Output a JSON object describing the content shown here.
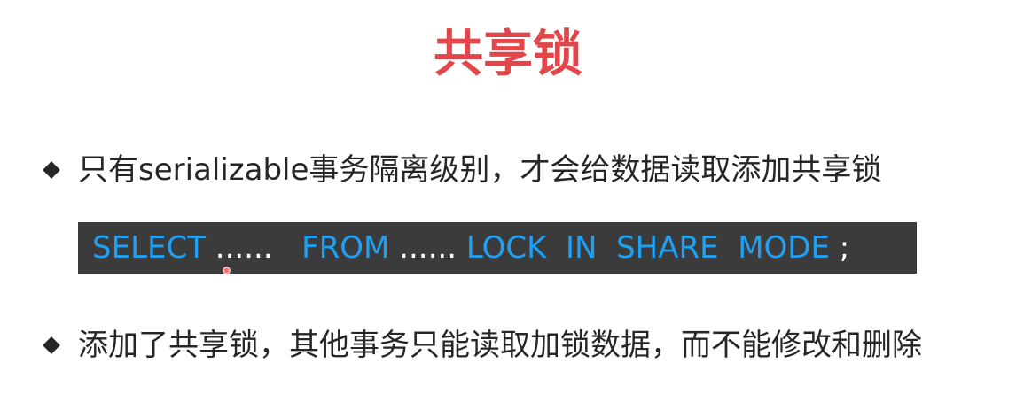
{
  "slide": {
    "title": "共享锁",
    "title_color": "#e0464a",
    "bullets": [
      {
        "icon": "diamond-bullet-icon",
        "text": "只有serializable事务隔离级别，才会给数据读取添加共享锁"
      },
      {
        "icon": "diamond-bullet-icon",
        "text": "添加了共享锁，其他事务只能读取加锁数据，而不能修改和删除"
      }
    ],
    "code": {
      "background": "#3b3b3b",
      "keyword_color": "#1ea0f5",
      "tokens": {
        "select": "SELECT",
        "dots1": " ......  ",
        "from": " FROM",
        "dots2": " ...... ",
        "lock": "LOCK  IN  SHARE  MODE",
        "semi": " ;"
      }
    }
  }
}
